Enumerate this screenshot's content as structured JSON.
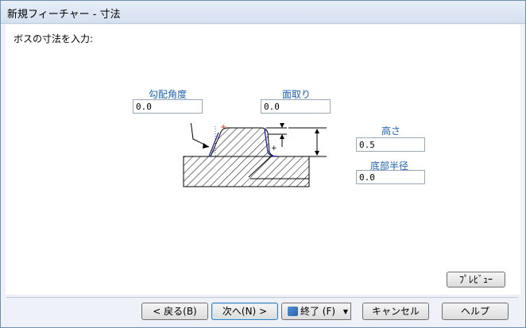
{
  "window": {
    "title": "新規フィーチャー - 寸法",
    "close_label": "✕"
  },
  "instruction": "ボスの寸法を入力:",
  "fields": {
    "draft_angle": {
      "label": "勾配角度",
      "value": "0.0"
    },
    "chamfer": {
      "label": "面取り",
      "value": "0.0"
    },
    "height": {
      "label": "高さ",
      "value": "0.5"
    },
    "fillet_radius": {
      "label": "底部半径",
      "value": "0.0"
    }
  },
  "buttons": {
    "preview": "ﾌﾟﾚﾋﾞｭｰ",
    "back": "< 戻る(B)",
    "next": "次へ(N) >",
    "finish": "終了 (F)",
    "cancel": "キャンセル",
    "help": "ヘルプ"
  },
  "colors": {
    "label_blue": "#1d62b0",
    "outline_blue": "#2a2aa8",
    "marker_red": "#e02020"
  }
}
